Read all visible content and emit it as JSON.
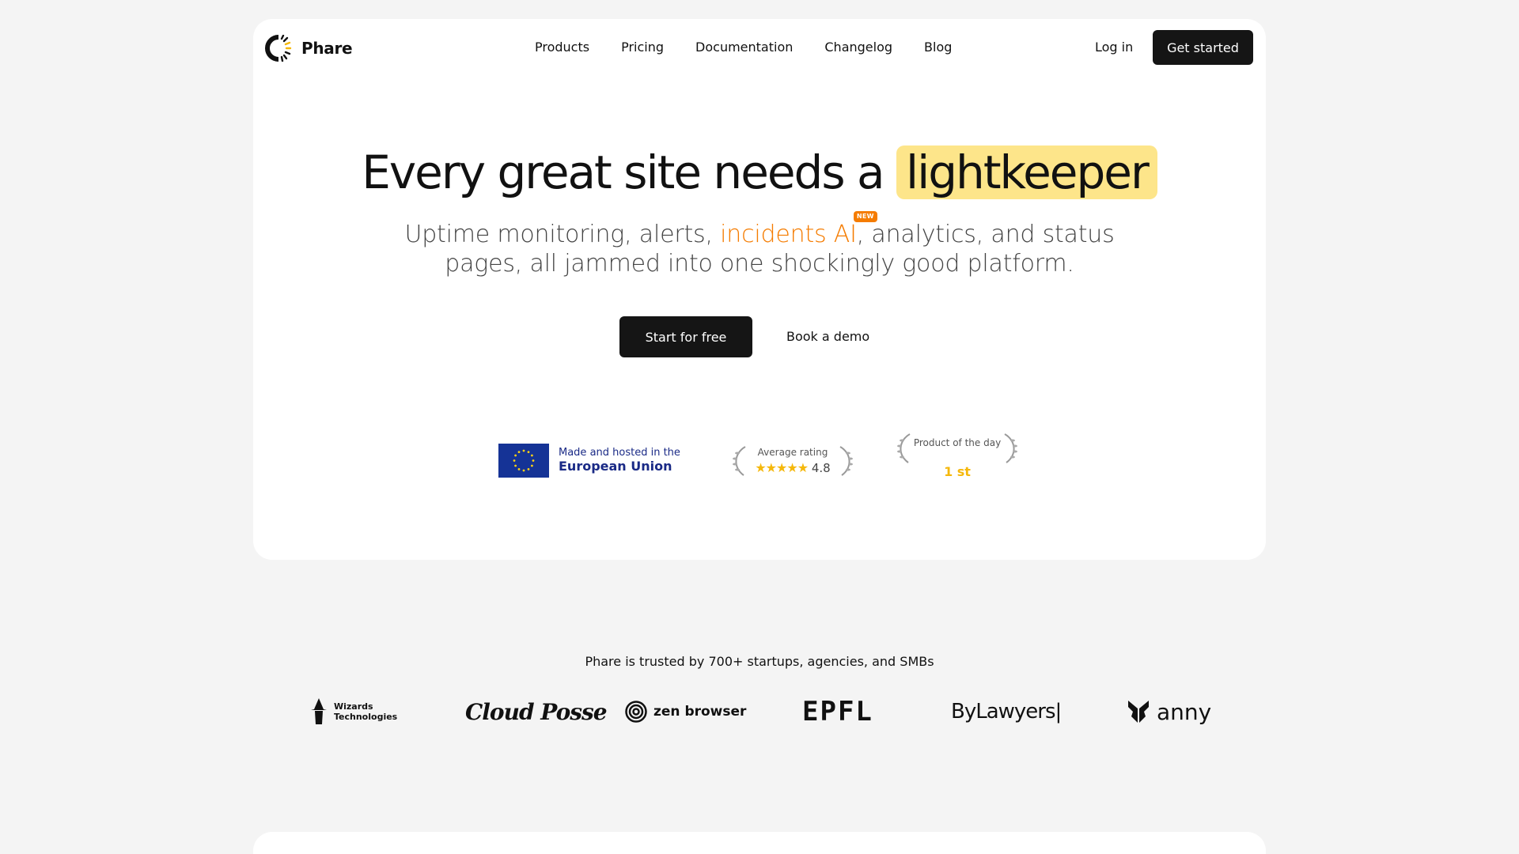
{
  "brand": {
    "name": "Phare"
  },
  "nav": {
    "items": [
      "Products",
      "Pricing",
      "Documentation",
      "Changelog",
      "Blog"
    ],
    "login": "Log in",
    "cta": "Get started"
  },
  "hero": {
    "headline_pre": "Every great site needs a",
    "headline_highlight": "lightkeeper",
    "sub_pre": "Uptime monitoring, alerts,",
    "sub_accent": "incidents AI",
    "sub_badge": "NEW",
    "sub_post": ", analytics, and status pages, all jammed into one shockingly good platform.",
    "primary_cta": "Start for free",
    "secondary_cta": "Book a demo"
  },
  "badges": {
    "eu_line1": "Made and hosted in the",
    "eu_line2": "European Union",
    "rating_label": "Average rating",
    "rating_stars": "★★★★★",
    "rating_value": "4.8",
    "potd_label": "Product of the day",
    "potd_rank": "1 st"
  },
  "trusted": {
    "text": "Phare is trusted by 700+ startups, agencies, and SMBs",
    "logos": {
      "wizards_line1": "Wizards",
      "wizards_line2": "Technologies",
      "cloudposse": "Cloud Posse",
      "zen": "zen browser",
      "epfl": "EPFL",
      "bylawyers": "ByLawyers|",
      "anny": "anny"
    }
  },
  "colors": {
    "highlight": "#fde58a",
    "accent": "#f57c00",
    "dark_button": "#151515",
    "eu_blue": "#153396",
    "star": "#f5b80c"
  }
}
